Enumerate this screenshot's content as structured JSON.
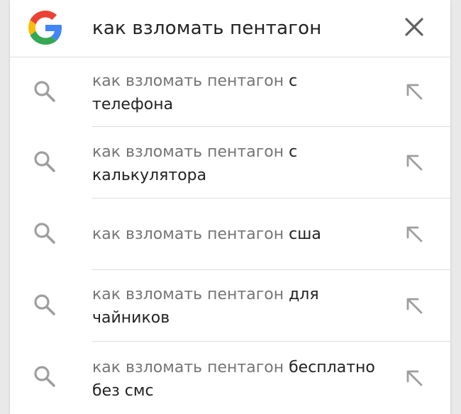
{
  "search": {
    "query": "как взломать пентагон",
    "logo_icon": "google-g-icon",
    "close_icon": "close-icon"
  },
  "colors": {
    "google_blue": "#4285F4",
    "google_red": "#EA4335",
    "google_yellow": "#FBBC05",
    "google_green": "#34A853",
    "suggestion_prefix": "#757575",
    "text": "#222222",
    "icon": "#9e9e9e"
  },
  "suggestions": [
    {
      "prefix": "как взломать пентагон",
      "suffix": "с",
      "line2": "телефона",
      "icon": "search-icon",
      "action_icon": "arrow-up-left-icon"
    },
    {
      "prefix": "как взломать пентагон",
      "suffix": "с",
      "line2": "калькулятора",
      "icon": "search-icon",
      "action_icon": "arrow-up-left-icon"
    },
    {
      "prefix": "как взломать пентагон",
      "suffix": "сша",
      "line2": "",
      "icon": "search-icon",
      "action_icon": "arrow-up-left-icon"
    },
    {
      "prefix": "как взломать пентагон",
      "suffix": "для",
      "line2": "чайников",
      "icon": "search-icon",
      "action_icon": "arrow-up-left-icon"
    },
    {
      "prefix": "как взломать пентагон",
      "suffix": "бесплатно",
      "line2": "без смс",
      "icon": "search-icon",
      "action_icon": "arrow-up-left-icon"
    }
  ]
}
